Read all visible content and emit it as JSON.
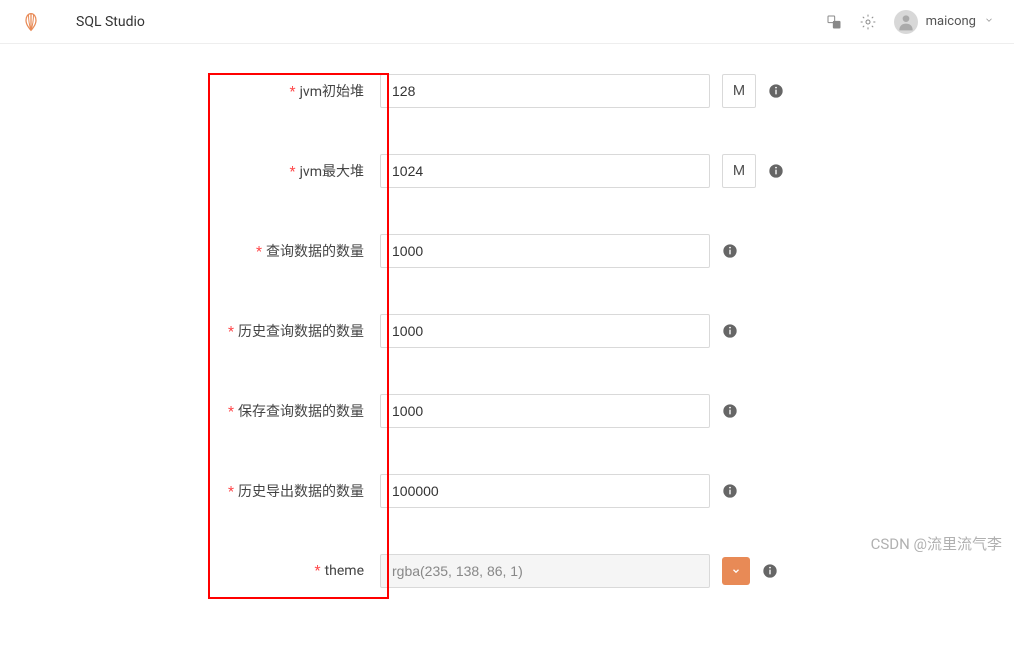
{
  "header": {
    "app_title": "SQL Studio",
    "username": "maicong"
  },
  "form": {
    "rows": [
      {
        "label": "jvm初始堆",
        "value": "128",
        "has_unit": true,
        "unit": "M",
        "has_color_btn": false,
        "disabled": false
      },
      {
        "label": "jvm最大堆",
        "value": "1024",
        "has_unit": true,
        "unit": "M",
        "has_color_btn": false,
        "disabled": false
      },
      {
        "label": "查询数据的数量",
        "value": "1000",
        "has_unit": false,
        "unit": "",
        "has_color_btn": false,
        "disabled": false
      },
      {
        "label": "历史查询数据的数量",
        "value": "1000",
        "has_unit": false,
        "unit": "",
        "has_color_btn": false,
        "disabled": false
      },
      {
        "label": "保存查询数据的数量",
        "value": "1000",
        "has_unit": false,
        "unit": "",
        "has_color_btn": false,
        "disabled": false
      },
      {
        "label": "历史导出数据的数量",
        "value": "100000",
        "has_unit": false,
        "unit": "",
        "has_color_btn": false,
        "disabled": false
      },
      {
        "label": "theme",
        "value": "rgba(235, 138, 86, 1)",
        "has_unit": false,
        "unit": "",
        "has_color_btn": true,
        "disabled": true
      }
    ]
  },
  "watermark": "CSDN @流里流气李",
  "colors": {
    "accent": "#e88a56"
  }
}
